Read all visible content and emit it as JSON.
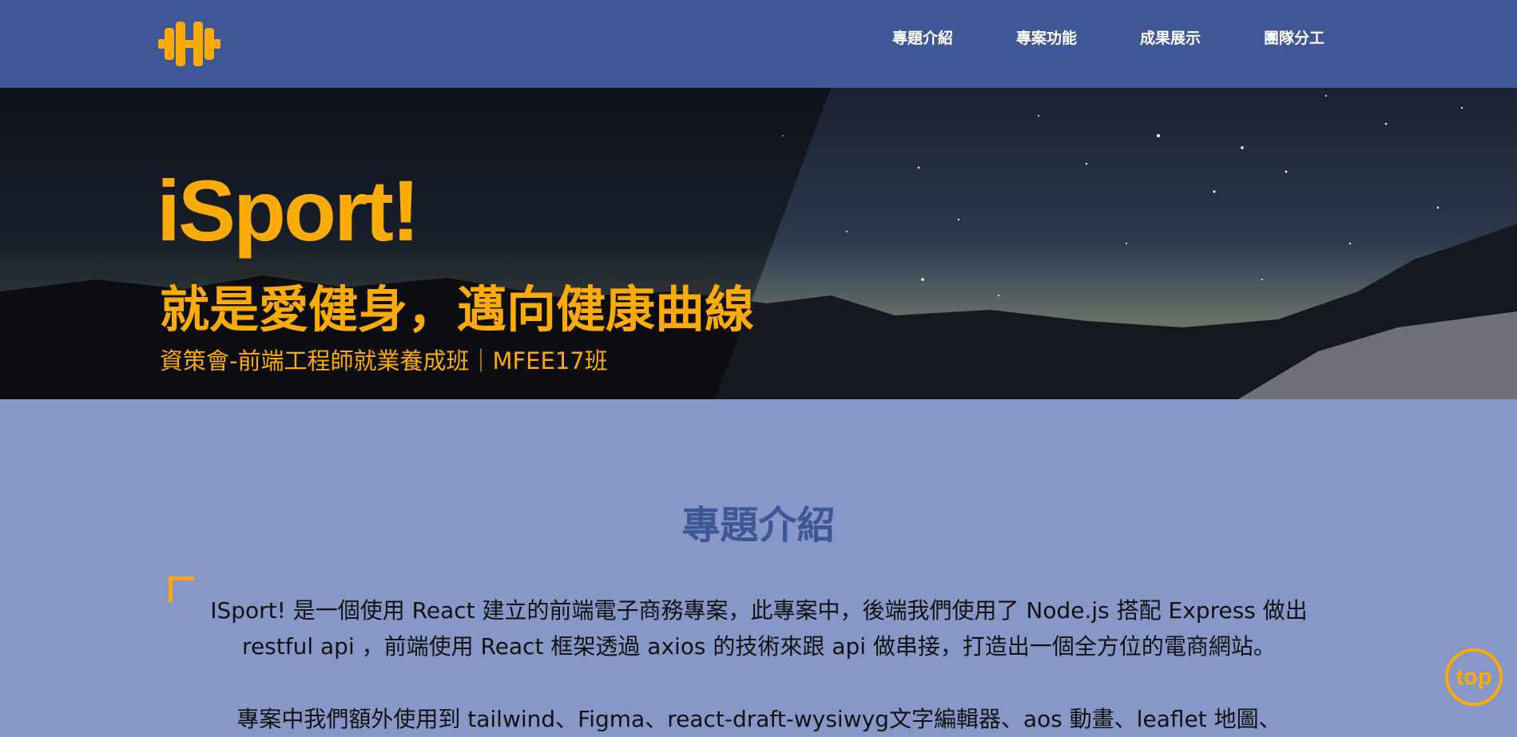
{
  "nav": {
    "logo_icon": "dumbbell-icon",
    "links": [
      {
        "label": "專題介紹"
      },
      {
        "label": "專案功能"
      },
      {
        "label": "成果展示"
      },
      {
        "label": "團隊分工"
      }
    ]
  },
  "hero": {
    "title": "iSport!",
    "subtitle": "就是愛健身，邁向健康曲線",
    "caption": "資策會-前端工程師就業養成班｜MFEE17班",
    "background": "starry-night-mountains"
  },
  "intro": {
    "heading": "專題介紹",
    "paragraph_1": "ISport! 是一個使用 React 建立的前端電子商務專案，此專案中，後端我們使用了 Node.js 搭配 Express 做出 restful api ，前端使用 React 框架透過 axios 的技術來跟 api 做串接，打造出一個全方位的電商網站。",
    "paragraph_2": "專案中我們額外使用到 tailwind、Figma、react-draft-wysiwyg文字編輯器、aos 動畫、leaflet 地圖、"
  },
  "top_button": {
    "label": "top"
  },
  "colors": {
    "navbar": "#3f5796",
    "page_background": "#8797c8",
    "accent": "#fcab04",
    "heading": "#3f5796"
  }
}
